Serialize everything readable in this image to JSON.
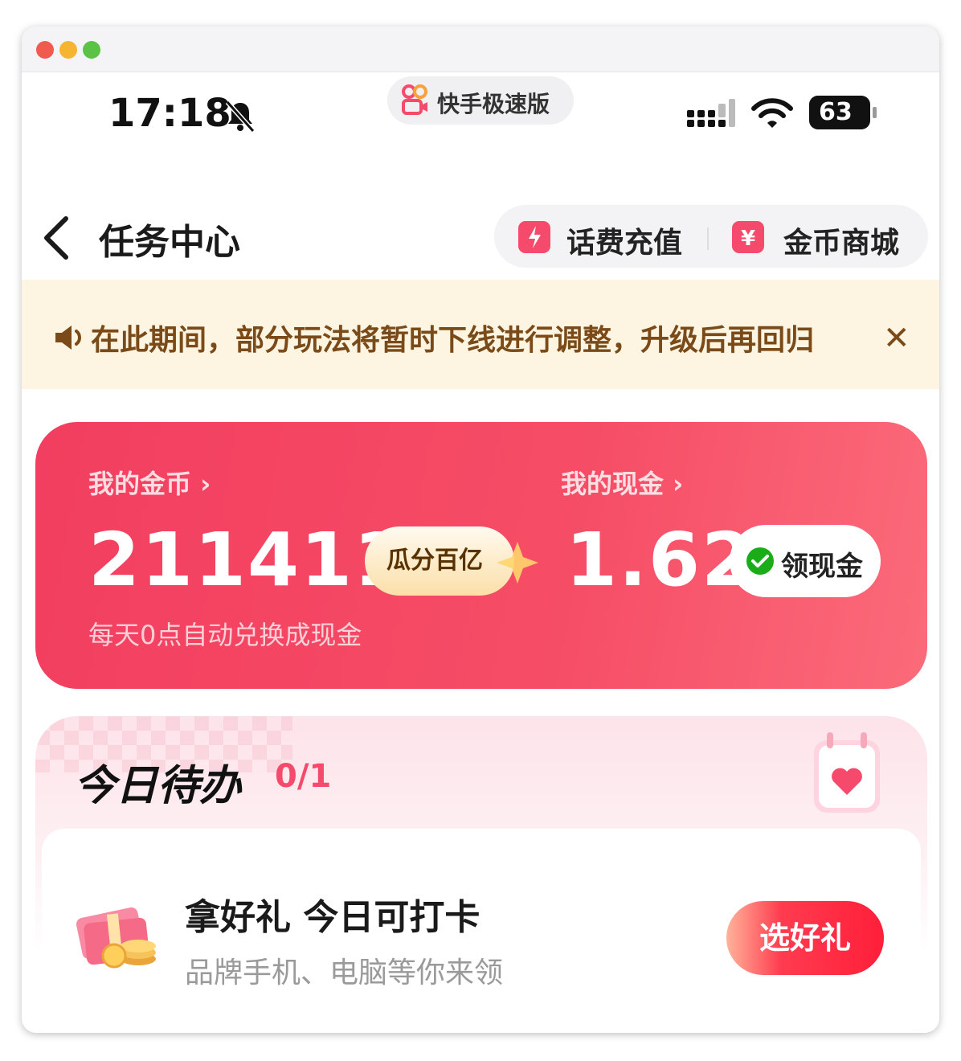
{
  "status_bar": {
    "time": "17:18",
    "app_name": "快手极速版",
    "battery": "63"
  },
  "header": {
    "title": "任务中心",
    "recharge_label": "话费充值",
    "mall_label": "金币商城"
  },
  "notice": {
    "text": "在此期间，部分玩法将暂时下线进行调整，升级后再回归",
    "close": "✕"
  },
  "balance": {
    "coins_label": "我的金币 ›",
    "coins_value": "211411",
    "gua_fen_label": "瓜分百亿",
    "cash_label": "我的现金 ›",
    "cash_value": "1.62",
    "withdraw_label": "领现金",
    "note": "每天0点自动兑换成现金"
  },
  "todo": {
    "title": "今日待办",
    "count": "0/1",
    "task": {
      "title": "拿好礼 今日可打卡",
      "subtitle": "品牌手机、电脑等你来领",
      "button_label": "选好礼"
    }
  },
  "colors": {
    "accent": "#f54a6b",
    "card": "#f23e60",
    "notice_bg": "#fdf4e2",
    "notice_text": "#7a4b18"
  }
}
